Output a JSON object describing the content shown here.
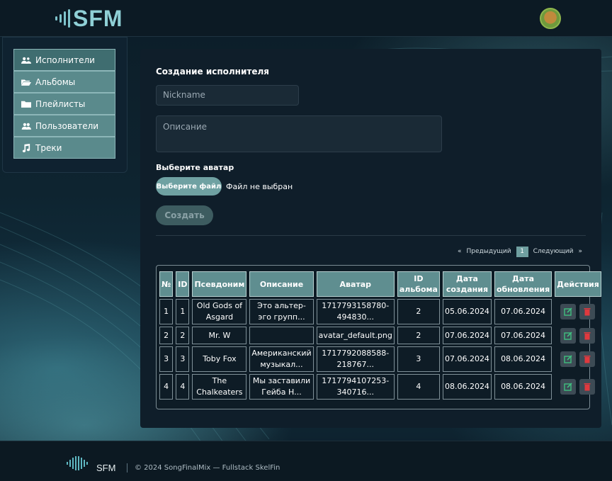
{
  "app": {
    "logo_text": "SFM"
  },
  "sidebar": {
    "items": [
      {
        "label": "Исполнители",
        "icon": "users-icon",
        "active": true
      },
      {
        "label": "Альбомы",
        "icon": "folder-open-icon",
        "active": false
      },
      {
        "label": "Плейлисты",
        "icon": "folder-icon",
        "active": false
      },
      {
        "label": "Пользователи",
        "icon": "user-group-icon",
        "active": false
      },
      {
        "label": "Треки",
        "icon": "music-note-icon",
        "active": false
      }
    ]
  },
  "form": {
    "title": "Создание исполнителя",
    "nickname_placeholder": "Nickname",
    "nickname_value": "",
    "description_placeholder": "Описание",
    "description_value": "",
    "avatar_label": "Выберите аватар",
    "file_button_label": "Выберите файл",
    "file_status": "Файл не выбран",
    "submit_label": "Создать"
  },
  "pagination": {
    "prev_arrow": "«",
    "prev_label": "Предыдущий",
    "current_page": "1",
    "next_label": "Следующий",
    "next_arrow": "»"
  },
  "table": {
    "headers": [
      "№",
      "ID",
      "Псевдоним",
      "Описание",
      "Аватар",
      "ID альбома",
      "Дата создания",
      "Дата обновления",
      "Действия"
    ],
    "rows": [
      {
        "num": "1",
        "id": "1",
        "nickname": "Old Gods of Asgard",
        "description": "Это альтер-эго групп...",
        "avatar": "1717793158780-494830...",
        "album_id": "2",
        "created": "05.06.2024",
        "updated": "07.06.2024"
      },
      {
        "num": "2",
        "id": "2",
        "nickname": "Mr. W",
        "description": "",
        "avatar": "avatar_default.png",
        "album_id": "2",
        "created": "07.06.2024",
        "updated": "07.06.2024"
      },
      {
        "num": "3",
        "id": "3",
        "nickname": "Toby Fox",
        "description": "Американский музыкал...",
        "avatar": "1717792088588-218767...",
        "album_id": "3",
        "created": "07.06.2024",
        "updated": "08.06.2024"
      },
      {
        "num": "4",
        "id": "4",
        "nickname": "The Chalkeaters",
        "description": "Мы заставили Гейба Н...",
        "avatar": "1717794107253-340716...",
        "album_id": "4",
        "created": "08.06.2024",
        "updated": "08.06.2024"
      }
    ]
  },
  "footer": {
    "logo_text": "SFM",
    "copyright": "© 2024 SongFinalMix — Fullstack SkelFin"
  },
  "colors": {
    "accent": "#6fa1a2",
    "sidebar_item": "#5a8a8c",
    "delete_icon": "#e0393e",
    "edit_icon": "#3fbf7f"
  }
}
